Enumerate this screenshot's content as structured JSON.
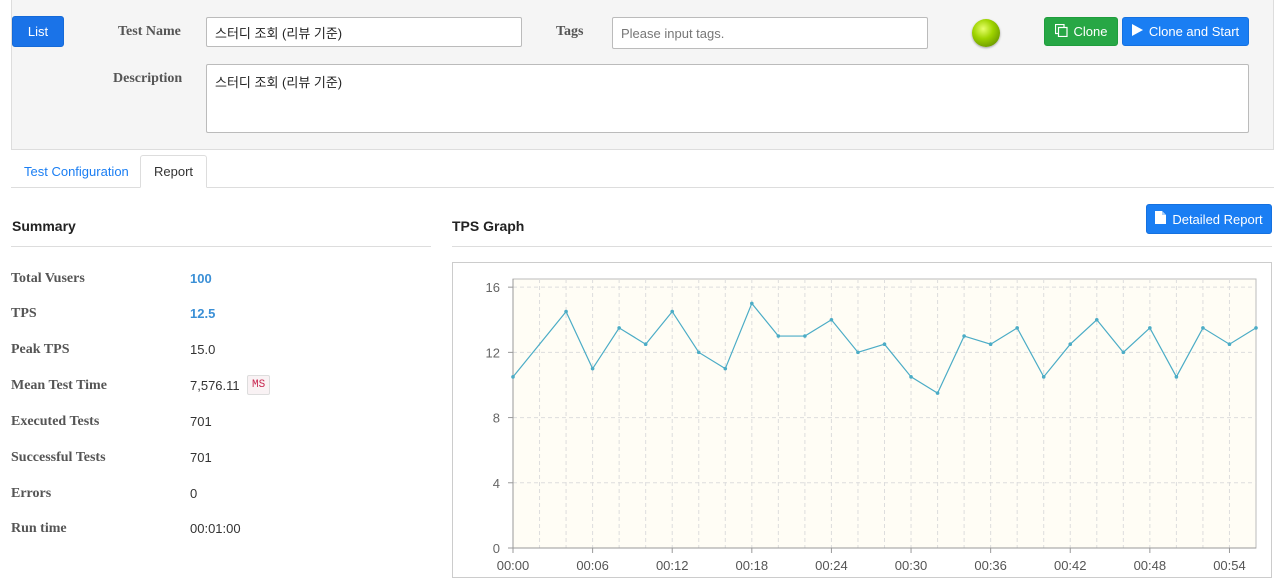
{
  "header": {
    "list_label": "List",
    "test_name_label": "Test Name",
    "test_name_value": "스터디 조회 (리뷰 기준)",
    "tags_label": "Tags",
    "tags_placeholder": "Please input tags.",
    "clone_label": "Clone",
    "clone_start_label": "Clone and Start",
    "description_label": "Description",
    "description_value": "스터디 조회 (리뷰 기준)"
  },
  "tabs": [
    {
      "label": "Test Configuration",
      "active": false
    },
    {
      "label": "Report",
      "active": true
    }
  ],
  "summary": {
    "title": "Summary",
    "rows": [
      {
        "key": "Total Vusers",
        "value": "100"
      },
      {
        "key": "TPS",
        "value": "12.5"
      },
      {
        "key": "Peak TPS",
        "value": "15.0"
      },
      {
        "key": "Mean Test Time",
        "value": "7,576.11",
        "unit": "MS"
      },
      {
        "key": "Executed Tests",
        "value": "701"
      },
      {
        "key": "Successful Tests",
        "value": "701"
      },
      {
        "key": "Errors",
        "value": "0"
      },
      {
        "key": "Run time",
        "value": "00:01:00"
      }
    ]
  },
  "graph": {
    "title": "TPS Graph",
    "detailed_report_label": "Detailed Report"
  },
  "colors": {
    "primary": "#1a7ef3",
    "success": "#27a745",
    "line": "#4bacc6",
    "plot_bg": "#fffdf5"
  },
  "chart_data": {
    "type": "line",
    "title": "",
    "xlabel": "",
    "ylabel": "",
    "ylim": [
      0,
      16.5
    ],
    "yticks": [
      0,
      4,
      8,
      12,
      16
    ],
    "xtick_labels": [
      "00:00",
      "00:06",
      "00:12",
      "00:18",
      "00:24",
      "00:30",
      "00:36",
      "00:42",
      "00:48",
      "00:54"
    ],
    "x_step_seconds": 2,
    "x_range_seconds": [
      0,
      56
    ],
    "series": [
      {
        "values": [
          10.5,
          14.5,
          11.0,
          13.5,
          12.5,
          14.5,
          12.0,
          11.0,
          15.0,
          13.0,
          13.0,
          14.0,
          12.0,
          12.5,
          10.5,
          9.5,
          13.0,
          12.5,
          13.5,
          10.5,
          12.5,
          14.0,
          12.0,
          13.5,
          10.5,
          13.5,
          12.5,
          13.5
        ],
        "x_seconds": [
          0,
          4,
          6,
          8,
          10,
          12,
          14,
          16,
          18,
          20,
          22,
          24,
          26,
          28,
          30,
          32,
          34,
          36,
          38,
          40,
          42,
          44,
          46,
          48,
          50,
          52,
          54,
          56
        ]
      }
    ]
  }
}
